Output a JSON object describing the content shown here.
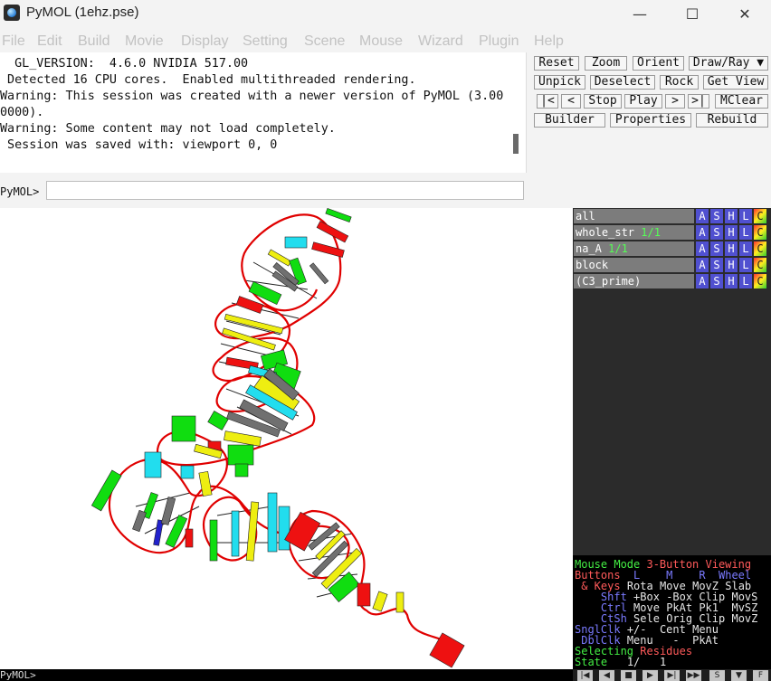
{
  "window": {
    "title": "PyMOL (1ehz.pse)",
    "minimize": "—",
    "maximize": "☐",
    "close": "✕"
  },
  "menu": [
    "File",
    "Edit",
    "Build",
    "Movie",
    "Display",
    "Setting",
    "Scene",
    "Mouse",
    "Wizard",
    "Plugin",
    "Help"
  ],
  "console": {
    "lines": [
      "  GL_VERSION:  4.6.0 NVIDIA 517.00",
      " Detected 16 CPU cores.  Enabled multithreaded rendering.",
      "Warning: This session was created with a newer version of PyMOL (3.00",
      "0000).",
      "Warning: Some content may not load completely.",
      " Session was saved with: viewport 0, 0"
    ],
    "prompt": "PyMOL>",
    "command_value": ""
  },
  "controls": {
    "row1": [
      "Reset",
      "Zoom",
      "Orient",
      "Draw/Ray ▼"
    ],
    "row2": [
      "Unpick",
      "Deselect",
      "Rock",
      "Get View"
    ],
    "row3": [
      "|<",
      "<",
      "Stop",
      "Play",
      ">",
      ">|",
      "MClear"
    ],
    "row4": [
      "Builder",
      "Properties",
      "Rebuild"
    ]
  },
  "objects": [
    {
      "name": "all",
      "state": ""
    },
    {
      "name": "whole_str",
      "state": " 1/1"
    },
    {
      "name": "na_A",
      "state": " 1/1"
    },
    {
      "name": "block",
      "state": ""
    },
    {
      "name": "(C3_prime)",
      "state": ""
    }
  ],
  "object_buttons": [
    "A",
    "S",
    "H",
    "L",
    "C"
  ],
  "mouse_panel": {
    "mode_label": "Mouse Mode",
    "mode_value": "3-Button Viewing",
    "buttons_label": "Buttons",
    "col_L": "L",
    "col_M": "M",
    "col_R": "R",
    "col_wheel": "Wheel",
    "keys_label": "& Keys",
    "row_none": [
      "Rota",
      "Move",
      "MovZ",
      "Slab"
    ],
    "shft_label": "Shft",
    "row_shft": [
      "+Box",
      "-Box",
      "Clip",
      "MovS"
    ],
    "ctrl_label": "Ctrl",
    "row_ctrl": [
      "Move",
      "PkAt",
      "Pk1",
      "MvSZ"
    ],
    "ctsh_label": "CtSh",
    "row_ctsh": [
      "Sele",
      "Orig",
      "Clip",
      "MovZ"
    ],
    "snglclk_label": "SnglClk",
    "row_snglclk": [
      "+/-",
      "Cent",
      "Menu"
    ],
    "dblclk_label": "DblClk",
    "row_dblclk": [
      "Menu",
      "-",
      "PkAt"
    ],
    "selecting_label": "Selecting",
    "selecting_value": "Residues",
    "state_label": "State",
    "state_value": "1/",
    "state_total": "1"
  },
  "bottom": {
    "prompt": "PyMOL>",
    "transport": [
      "|◀",
      "◀",
      "■",
      "▶",
      "▶|",
      "▶▶",
      "S",
      "▼",
      "F"
    ]
  },
  "colors": {
    "backbone": "#e00000",
    "base_green": "#10dd10",
    "base_cyan": "#22ddee",
    "base_yellow": "#eeee11",
    "base_red": "#ee1111",
    "base_gray": "#707070",
    "base_blue": "#2222cc"
  }
}
